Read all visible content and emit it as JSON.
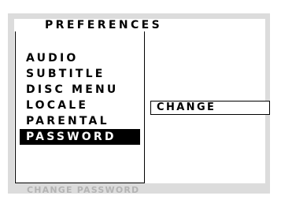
{
  "menu": {
    "title": "PREFERENCES",
    "items": [
      {
        "label": "AUDIO"
      },
      {
        "label": "SUBTITLE"
      },
      {
        "label": "DISC MENU"
      },
      {
        "label": "LOCALE"
      },
      {
        "label": "PARENTAL"
      },
      {
        "label": "PASSWORD"
      }
    ],
    "selected_index": 5
  },
  "submenu": {
    "option_label": "CHANGE"
  },
  "status": {
    "hint": "CHANGE PASSWORD"
  },
  "colors": {
    "background": "#ffffff",
    "frame": "#dcdcdc",
    "highlight_bg": "#000000",
    "highlight_fg": "#ffffff",
    "hint_text": "#b4b4b4"
  }
}
